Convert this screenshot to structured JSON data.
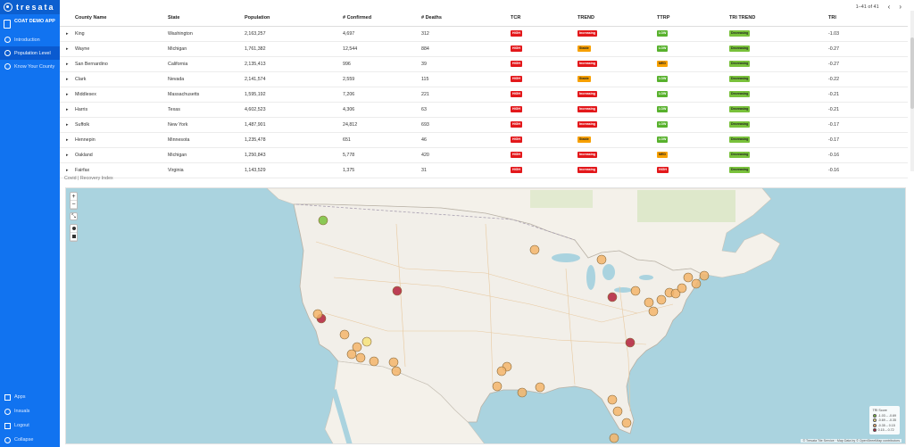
{
  "brand": {
    "name": "tresata"
  },
  "sidebar": {
    "app_title": "COAT DEMO APP",
    "items": [
      {
        "label": "Introduction"
      },
      {
        "label": "Population Level"
      },
      {
        "label": "Know Your County"
      }
    ],
    "bottom": [
      {
        "label": "Apps"
      },
      {
        "label": "Insuals"
      },
      {
        "label": "Logout"
      },
      {
        "label": "Collapse"
      }
    ]
  },
  "pager": {
    "range": "1–41 of 41",
    "prev": "‹",
    "next": "›"
  },
  "table": {
    "columns": [
      "County Name",
      "State",
      "Population",
      "# Confirmed",
      "# Deaths",
      "TCR",
      "TREND",
      "TTRP",
      "TRI TREND",
      "TRI"
    ],
    "rows": [
      {
        "county": "King",
        "state": "Washington",
        "population": "2,163,257",
        "confirmed": "4,697",
        "deaths": "312",
        "tcr": "HIGH",
        "trend": "Increasing",
        "ttrp": "LOW",
        "tri_trend": "Decreasing",
        "tri": "-1.03"
      },
      {
        "county": "Wayne",
        "state": "Michigan",
        "population": "1,761,382",
        "confirmed": "12,544",
        "deaths": "884",
        "tcr": "HIGH",
        "trend": "Stable",
        "ttrp": "LOW",
        "tri_trend": "Decreasing",
        "tri": "-0.27"
      },
      {
        "county": "San Bernardino",
        "state": "California",
        "population": "2,135,413",
        "confirmed": "996",
        "deaths": "39",
        "tcr": "HIGH",
        "trend": "Increasing",
        "ttrp": "MED",
        "tri_trend": "Decreasing",
        "tri": "-0.27"
      },
      {
        "county": "Clark",
        "state": "Nevada",
        "population": "2,141,574",
        "confirmed": "2,559",
        "deaths": "115",
        "tcr": "HIGH",
        "trend": "Stable",
        "ttrp": "LOW",
        "tri_trend": "Decreasing",
        "tri": "-0.22"
      },
      {
        "county": "Middlesex",
        "state": "Massachusetts",
        "population": "1,595,192",
        "confirmed": "7,206",
        "deaths": "221",
        "tcr": "HIGH",
        "trend": "Increasing",
        "ttrp": "LOW",
        "tri_trend": "Decreasing",
        "tri": "-0.21"
      },
      {
        "county": "Harris",
        "state": "Texas",
        "population": "4,602,523",
        "confirmed": "4,306",
        "deaths": "63",
        "tcr": "HIGH",
        "trend": "Increasing",
        "ttrp": "LOW",
        "tri_trend": "Decreasing",
        "tri": "-0.21"
      },
      {
        "county": "Suffolk",
        "state": "New York",
        "population": "1,487,901",
        "confirmed": "24,812",
        "deaths": "693",
        "tcr": "HIGH",
        "trend": "Increasing",
        "ttrp": "LOW",
        "tri_trend": "Decreasing",
        "tri": "-0.17"
      },
      {
        "county": "Hennepin",
        "state": "Minnesota",
        "population": "1,235,478",
        "confirmed": "651",
        "deaths": "46",
        "tcr": "HIGH",
        "trend": "Stable",
        "ttrp": "LOW",
        "tri_trend": "Decreasing",
        "tri": "-0.17"
      },
      {
        "county": "Oakland",
        "state": "Michigan",
        "population": "1,250,843",
        "confirmed": "5,778",
        "deaths": "420",
        "tcr": "HIGH",
        "trend": "Increasing",
        "ttrp": "MED",
        "tri_trend": "Decreasing",
        "tri": "-0.16"
      },
      {
        "county": "Fairfax",
        "state": "Virginia",
        "population": "1,143,529",
        "confirmed": "1,375",
        "deaths": "31",
        "tcr": "HIGH",
        "trend": "Increasing",
        "ttrp": "HIGH",
        "tri_trend": "Decreasing",
        "tri": "-0.16"
      }
    ]
  },
  "map": {
    "section_label": "Covid | Recovery Index",
    "controls": {
      "zoom_in": "+",
      "zoom_out": "−"
    },
    "legend": {
      "title": "TRI Score",
      "items": [
        {
          "label": "-1.03 – -0.69",
          "color": "#79c13b"
        },
        {
          "label": "-0.69 – -0.35",
          "color": "#f6e27a"
        },
        {
          "label": "-0.35 – 0.15",
          "color": "#f5b56b"
        },
        {
          "label": "0.15 – 0.72",
          "color": "#b3203b"
        }
      ]
    },
    "attribution": "© Tresata Tile Service · Map Data by © OpenStreetMap contributors",
    "colors": {
      "water": "#aad3df",
      "land": "#f2efe9",
      "canada": "#f4f1ea"
    }
  }
}
